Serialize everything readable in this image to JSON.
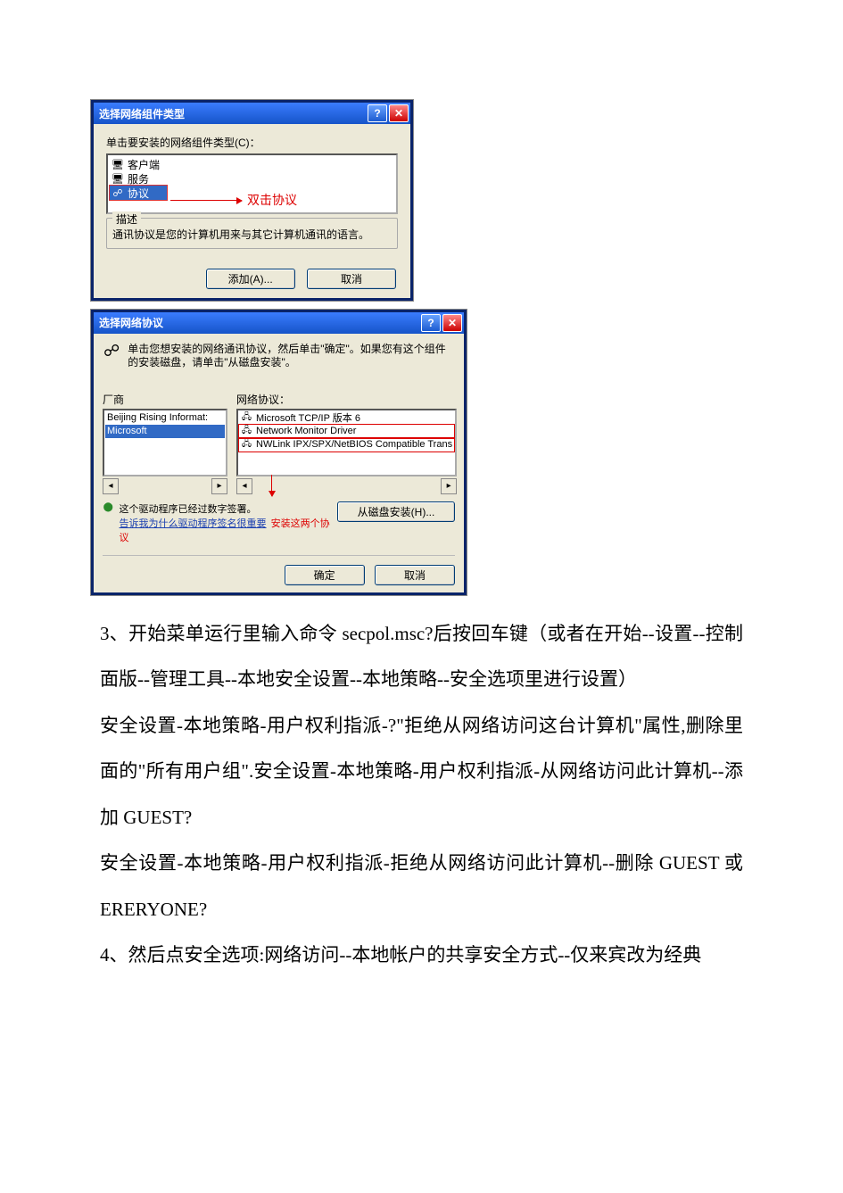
{
  "dialog1": {
    "title": "选择网络组件类型",
    "instruction": "单击要安装的网络组件类型(C)：",
    "items": [
      {
        "label": "客户端"
      },
      {
        "label": "服务"
      },
      {
        "label": "协议",
        "selected": true
      }
    ],
    "annotation": "双击协议",
    "desc_legend": "描述",
    "desc_text": "通讯协议是您的计算机用来与其它计算机通讯的语言。",
    "btn_add": "添加(A)...",
    "btn_cancel": "取消"
  },
  "dialog2": {
    "title": "选择网络协议",
    "hint": "单击您想安装的网络通讯协议，然后单击\"确定\"。如果您有这个组件的安装磁盘，请单击\"从磁盘安装\"。",
    "col_vendor": "厂商",
    "col_proto": "网络协议：",
    "vendors": [
      {
        "label": "Beijing Rising Informat:"
      },
      {
        "label": "Microsoft",
        "selected": true
      }
    ],
    "protocols": [
      {
        "label": "Microsoft TCP/IP 版本 6"
      },
      {
        "label": "Network Monitor Driver",
        "boxed": true
      },
      {
        "label": "NWLink IPX/SPX/NetBIOS Compatible Trans",
        "boxed": true
      }
    ],
    "sig_line1": "这个驱动程序已经过数字签署。",
    "sig_link": "告诉我为什么驱动程序签名很重要",
    "annotation": "安装这两个协议",
    "btn_disk": "从磁盘安装(H)...",
    "btn_ok": "确定",
    "btn_cancel": "取消"
  },
  "text": {
    "p1": "3、开始菜单运行里输入命令 secpol.msc?后按回车键（或者在开始--设置--控制面版--管理工具--本地安全设置--本地策略--安全选项里进行设置）",
    "p2": "安全设置-本地策略-用户权利指派-?\"拒绝从网络访问这台计算机\"属性,删除里面的\"所有用户组\".安全设置-本地策略-用户权利指派-从网络访问此计算机--添加 GUEST?",
    "p3": "安全设置-本地策略-用户权利指派-拒绝从网络访问此计算机--删除 GUEST 或ERERYONE?",
    "p4": "4、然后点安全选项:网络访问--本地帐户的共享安全方式--仅来宾改为经典"
  }
}
